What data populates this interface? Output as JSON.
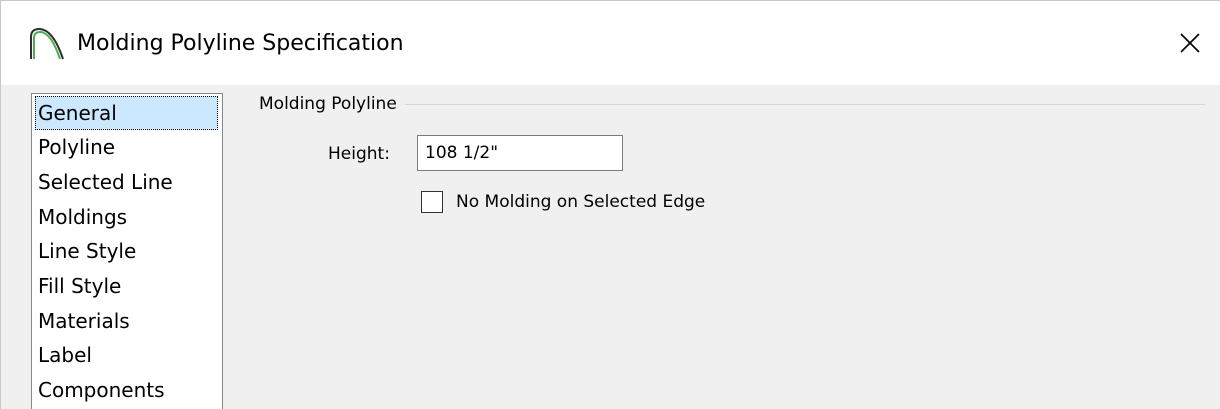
{
  "window": {
    "title": "Molding Polyline Specification",
    "icon": "molding-polyline-icon",
    "close_icon": "close-icon"
  },
  "sidebar": {
    "items": [
      {
        "label": "General",
        "selected": true
      },
      {
        "label": "Polyline",
        "selected": false
      },
      {
        "label": "Selected Line",
        "selected": false
      },
      {
        "label": "Moldings",
        "selected": false
      },
      {
        "label": "Line Style",
        "selected": false
      },
      {
        "label": "Fill Style",
        "selected": false
      },
      {
        "label": "Materials",
        "selected": false
      },
      {
        "label": "Label",
        "selected": false
      },
      {
        "label": "Components",
        "selected": false
      }
    ],
    "selected_color": "#cce8ff"
  },
  "general": {
    "group_title": "Molding Polyline",
    "height_label": "Height:",
    "height_value": "108 1/2\"",
    "no_molding_label": "No Molding on Selected Edge",
    "no_molding_checked": false
  }
}
